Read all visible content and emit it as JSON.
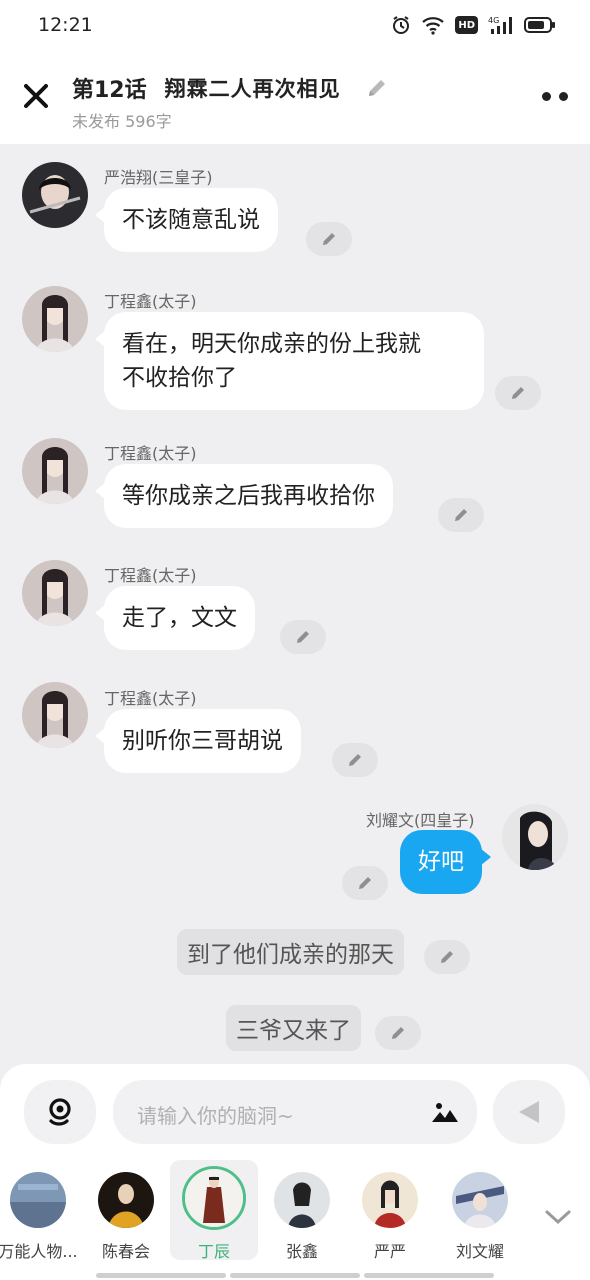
{
  "status_bar": {
    "time": "12:21",
    "icons": [
      "alarm-icon",
      "wifi-icon",
      "hd-icon",
      "signal-4g-icon",
      "battery-icon"
    ],
    "hd_label": "HD",
    "net_label": "4G"
  },
  "header": {
    "chapter": "第12话",
    "title": "翔霖二人再次相见",
    "subtitle": "未发布 596字",
    "close_icon": "close-icon",
    "edit_icon": "pencil-icon",
    "more_icon": "more-icon"
  },
  "messages": [
    {
      "speaker": "严浩翔(三皇子)",
      "text": "不该随意乱说",
      "side": "left"
    },
    {
      "speaker": "丁程鑫(太子)",
      "text_line1": "看在，明天你成亲的份上我就",
      "text_line2": "不收拾你了",
      "side": "left"
    },
    {
      "speaker": "丁程鑫(太子)",
      "text": "等你成亲之后我再收拾你",
      "side": "left"
    },
    {
      "speaker": "丁程鑫(太子)",
      "text": "走了，文文",
      "side": "left"
    },
    {
      "speaker": "丁程鑫(太子)",
      "text": "别听你三哥胡说",
      "side": "left"
    },
    {
      "speaker": "刘耀文(四皇子)",
      "text": "好吧",
      "side": "right"
    }
  ],
  "narrations": [
    {
      "text": "到了他们成亲的那天"
    },
    {
      "text": "三爷又来了"
    }
  ],
  "composer": {
    "placeholder": "请输入你的脑洞~",
    "mic_icon": "voice-icon",
    "image_icon": "image-icon",
    "send_icon": "send-icon"
  },
  "characters": [
    {
      "label": "万能人物..."
    },
    {
      "label": "陈春会"
    },
    {
      "label": "丁辰",
      "selected": true
    },
    {
      "label": "张鑫"
    },
    {
      "label": "严严"
    },
    {
      "label": "刘文耀"
    }
  ],
  "colors": {
    "accent_blue": "#18a7f0",
    "selected_green": "#3fb27a",
    "background": "#efeff1"
  }
}
